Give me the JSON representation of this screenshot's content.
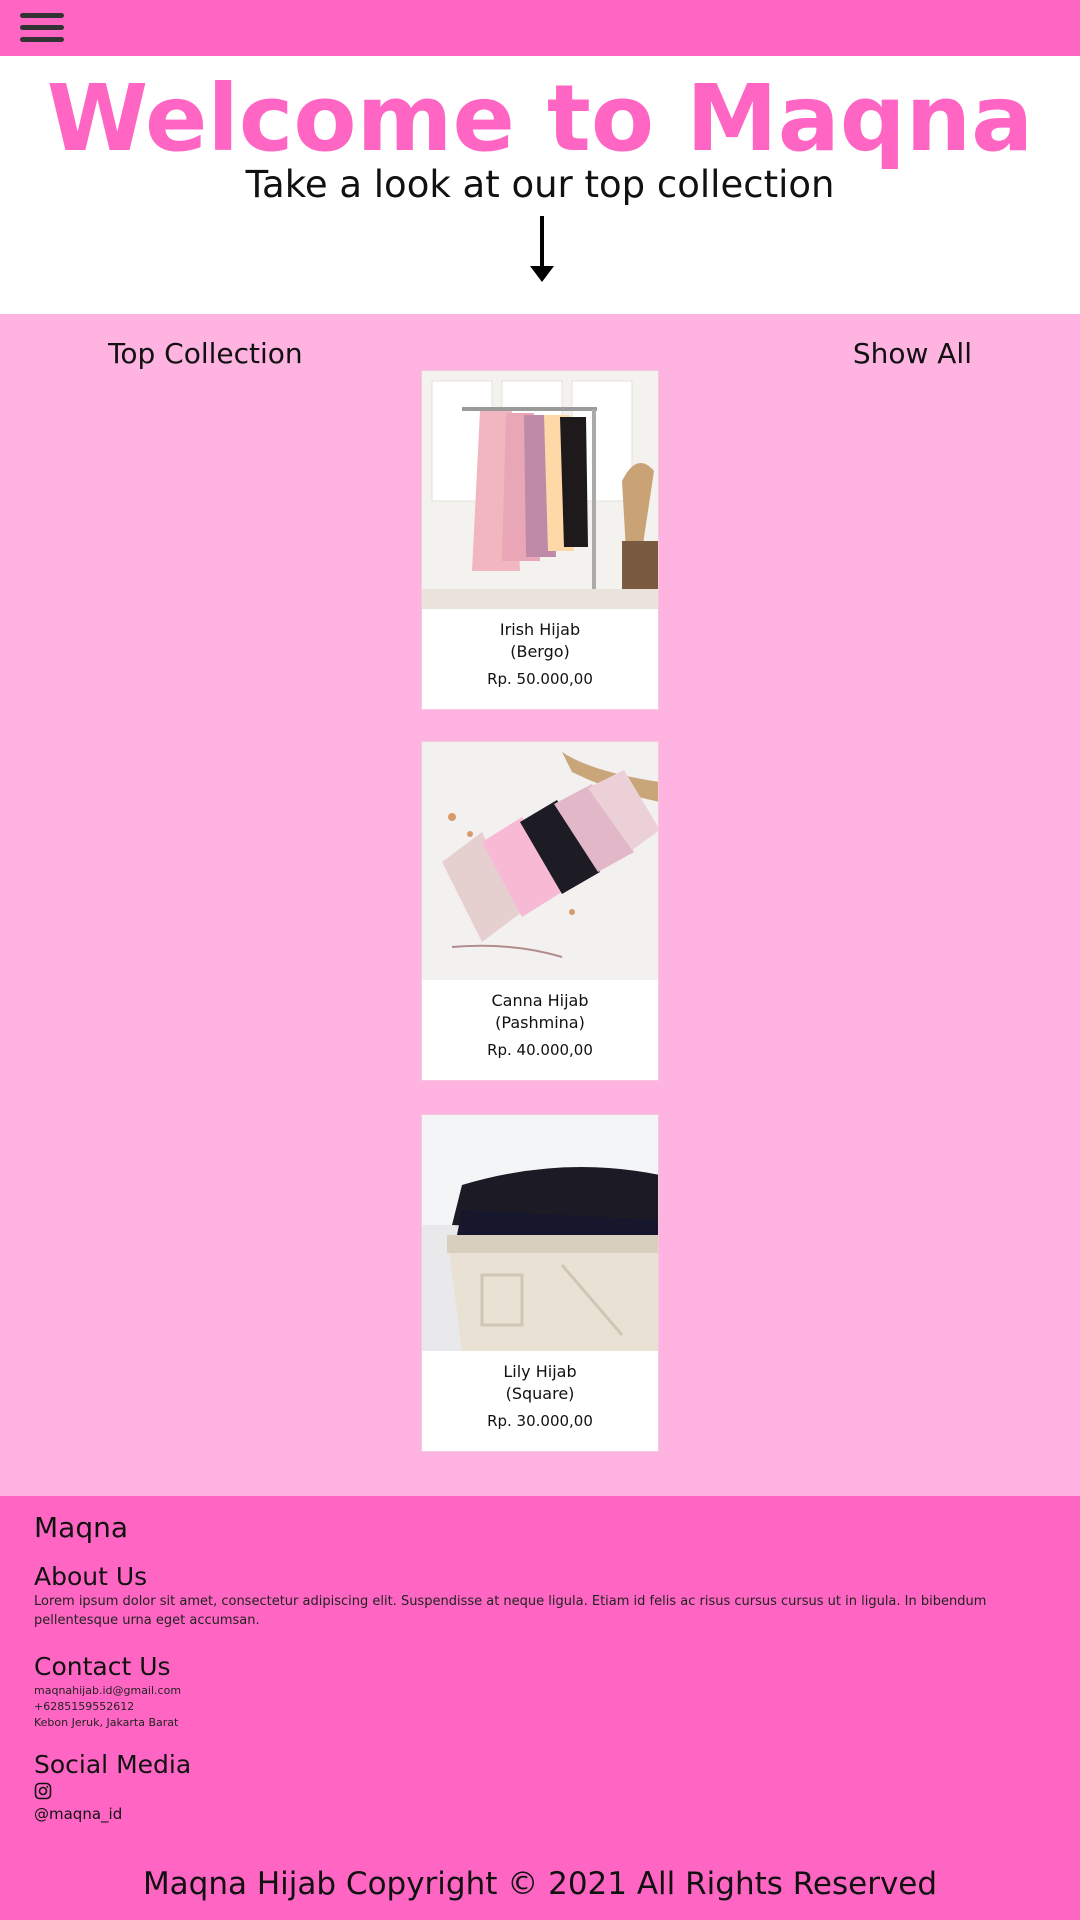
{
  "header": {
    "menu_icon": "hamburger-menu-icon",
    "bar_color": "#ff66c4"
  },
  "hero": {
    "title": "Welcome to Maqna",
    "subtitle": "Take a look at our top collection",
    "arrow_icon": "arrow-down-icon",
    "title_color": "#ff66c4"
  },
  "collection": {
    "title": "Top Collection",
    "show_all": "Show All",
    "background": "#ffb3e1",
    "products": [
      {
        "name_line1": "Irish Hijab",
        "name_line2": "(Bergo)",
        "price": "Rp. 50.000,00",
        "image": "hanging-hijabs-photo"
      },
      {
        "name_line1": "Canna Hijab",
        "name_line2": "(Pashmina)",
        "price": "Rp. 40.000,00",
        "image": "folded-pashmina-photo"
      },
      {
        "name_line1": "Lily Hijab",
        "name_line2": "(Square)",
        "price": "Rp. 30.000,00",
        "image": "stacked-square-hijab-photo"
      }
    ]
  },
  "footer": {
    "brand": "Maqna",
    "about_title": "About Us",
    "about_text": "Lorem ipsum dolor sit amet, consectetur adipiscing elit. Suspendisse at neque ligula. Etiam id felis ac risus cursus cursus ut in ligula. In bibendum pellentesque urna eget accumsan.",
    "contact_title": "Contact Us",
    "email": "maqnahijab.id@gmail.com",
    "phone": "+6285159552612",
    "address": "Kebon Jeruk, Jakarta Barat",
    "social_title": "Social Media",
    "instagram_icon": "instagram-icon",
    "instagram_handle": "@maqna_id",
    "copyright": "Maqna Hijab Copyright © 2021 All Rights Reserved",
    "background": "#ff66c4"
  }
}
